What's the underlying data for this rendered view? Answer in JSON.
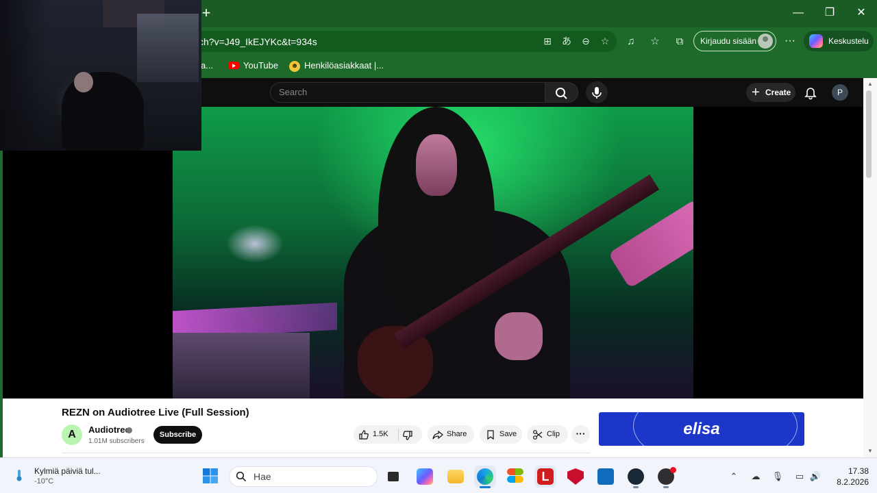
{
  "browser": {
    "url": "ch?v=J49_IkEJYKc&t=934s",
    "signin_label": "Kirjaudu sisään",
    "copilot_label": "Keskustelu",
    "bookmarks": [
      {
        "label": "a...",
        "icon": "generic-icon"
      },
      {
        "label": "YouTube",
        "icon": "youtube-icon"
      },
      {
        "label": "Henkilöasiakkaat |...",
        "icon": "favicon-badge-icon"
      }
    ],
    "theme_color": "#1e6a2a"
  },
  "youtube": {
    "search_placeholder": "Search",
    "create_label": "Create",
    "avatar_letter": "P",
    "video": {
      "title": "REZN on Audiotree Live (Full Session)",
      "channel": "Audiotree",
      "channel_initial": "A",
      "subscribers": "1.01M subscribers",
      "subscribe_label": "Subscribe",
      "likes": "1.5K",
      "share_label": "Share",
      "save_label": "Save",
      "clip_label": "Clip",
      "more_label": "···"
    },
    "ad": {
      "brand": "elisa",
      "color": "#1c36c9"
    }
  },
  "taskbar": {
    "weather_title": "Kylmiä päiviä tul...",
    "weather_temp": "-10°C",
    "search_placeholder": "Hae",
    "time": "17.38",
    "date": "8.2.2026"
  }
}
